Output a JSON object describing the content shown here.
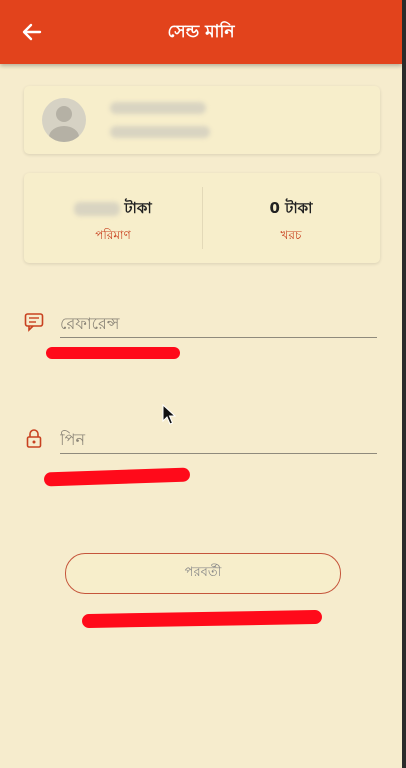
{
  "header": {
    "title": "সেন্ড মানি",
    "back_icon": "arrow-left-icon",
    "color": "#e2431c"
  },
  "amounts": {
    "balance_value": "টাকা",
    "balance_label": "পরিমাণ",
    "cost_value": "0 টাকা",
    "cost_label": "খরচ"
  },
  "form": {
    "reference_placeholder": "রেফারেন্স",
    "pin_placeholder": "পিন",
    "next_label": "পরবর্তী"
  },
  "colors": {
    "background": "#f6eccd",
    "accent": "#c8411f",
    "redaction": "#ff0a1a"
  }
}
